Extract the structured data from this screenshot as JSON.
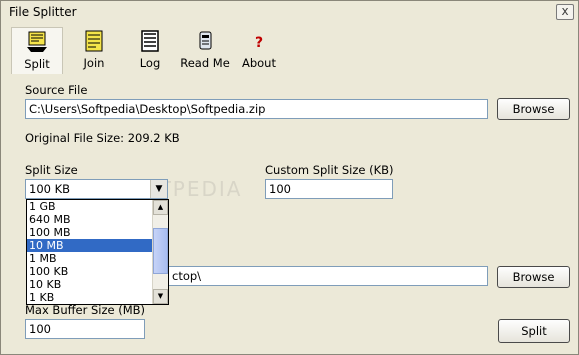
{
  "window": {
    "title": "File Splitter",
    "close_label": "x"
  },
  "toolbar": {
    "items": [
      {
        "label": "Split",
        "icon": "split-icon"
      },
      {
        "label": "Join",
        "icon": "join-icon"
      },
      {
        "label": "Log",
        "icon": "log-icon"
      },
      {
        "label": "Read Me",
        "icon": "readme-icon"
      },
      {
        "label": "About",
        "icon": "about-icon"
      }
    ]
  },
  "source": {
    "label": "Source File",
    "path": "C:\\Users\\Softpedia\\Desktop\\Softpedia.zip",
    "browse_label": "Browse",
    "original_size_text": "Original File Size: 209.2 KB"
  },
  "split_size": {
    "label": "Split Size",
    "selected": "100 KB",
    "options": [
      "1 GB",
      "640 MB",
      "100 MB",
      "10 MB",
      "1 MB",
      "100 KB",
      "10 KB",
      "1 KB"
    ],
    "highlighted": "10 MB"
  },
  "custom_split": {
    "label": "Custom Split Size (KB)",
    "value": "100"
  },
  "destination": {
    "path_visible": "ctop\\",
    "browse_label": "Browse"
  },
  "buffer": {
    "label": "Max Buffer Size (MB)",
    "value": "100"
  },
  "split_button_label": "Split",
  "colors": {
    "selection": "#316ac5",
    "face": "#ece9d8"
  }
}
